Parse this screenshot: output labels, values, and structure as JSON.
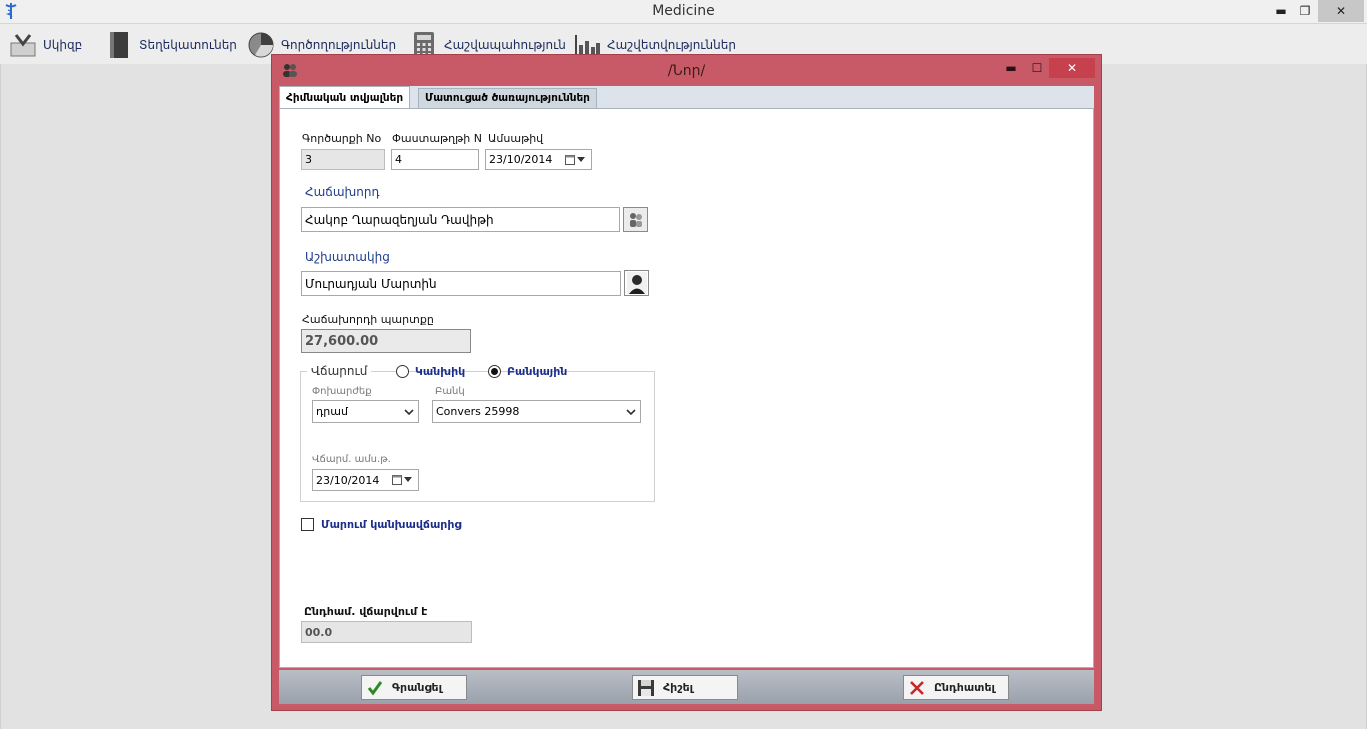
{
  "app": {
    "title": "Medicine"
  },
  "window_controls": {
    "minimize": "▬",
    "restore": "❐",
    "close": "✕"
  },
  "menu": [
    {
      "label": "Սկիզբ",
      "icon": "inbox-icon"
    },
    {
      "label": "Տեղեկատուներ",
      "icon": "book-icon"
    },
    {
      "label": "Գործողություններ",
      "icon": "pie-chart-icon"
    },
    {
      "label": "Հաշվապահություն",
      "icon": "calculator-icon"
    },
    {
      "label": "Հաշվետվություններ",
      "icon": "bar-chart-icon"
    }
  ],
  "dialog": {
    "title": "/Նոր/",
    "controls": {
      "minimize": "▬",
      "maximize": "☐",
      "close": "✕"
    },
    "tabs": [
      {
        "label": "Հիմնական տվյալներ",
        "active": true
      },
      {
        "label": "Մատուցած ծառայություններ",
        "active": false
      }
    ],
    "form": {
      "card_no": {
        "label": "Գործարքի No",
        "value": "3"
      },
      "doc_no": {
        "label": "Փաստաթղթի N",
        "value": "4"
      },
      "date": {
        "label": "Ամսաթիվ",
        "value": "23/10/2014"
      },
      "client": {
        "label": "Հաճախորդ",
        "value": "Հակոբ Ղարազեղյան Դավիթի"
      },
      "employee": {
        "label": "Աշխատակից",
        "value": "Մուրադյան Մարտին"
      },
      "client_debt": {
        "label": "Հաճախորդի պարտքը",
        "value": "27,600.00"
      },
      "payment": {
        "legend": "Վճարում",
        "options": [
          {
            "label": "Կանխիկ",
            "selected": false
          },
          {
            "label": "Բանկային",
            "selected": true
          }
        ],
        "currency": {
          "label": "Փոխարժեք",
          "value": "դրամ"
        },
        "bank": {
          "label": "Բանկ",
          "value": "Convers 25998"
        },
        "pay_date": {
          "label": "Վճարմ. ամս.թ.",
          "value": "23/10/2014"
        }
      },
      "deposit_checkbox": {
        "label": "Մարում կանխավճարից",
        "checked": false
      },
      "total_paid": {
        "label": "Ընդհամ. վճարվում է",
        "value": "00.0"
      }
    },
    "buttons": {
      "save_record": "Գրանցել",
      "save": "Հիշել",
      "cancel": "Ընդհատել"
    }
  }
}
